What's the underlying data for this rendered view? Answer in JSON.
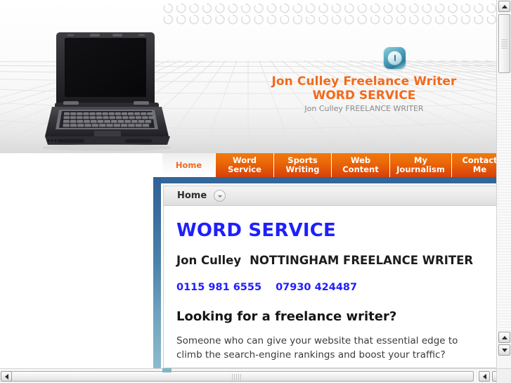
{
  "branding": {
    "logo_icon": "power-button-icon",
    "line1": "Jon Culley Freelance Writer",
    "line2": "WORD SERVICE",
    "tagline": "Jon Culley FREELANCE WRITER",
    "accent_orange": "#f26a1b",
    "accent_blue": "#1f1fff",
    "nav_blue": "#336699"
  },
  "hero": {
    "image_alt": "open-laptop-on-perspective-grid"
  },
  "nav": {
    "items": [
      {
        "label_line1": "Home",
        "label_line2": "",
        "active": true,
        "width": 76
      },
      {
        "label_line1": "Word",
        "label_line2": "Service",
        "active": false,
        "width": 83
      },
      {
        "label_line1": "Sports",
        "label_line2": "Writing",
        "active": false,
        "width": 82
      },
      {
        "label_line1": "Web",
        "label_line2": "Content",
        "active": false,
        "width": 83
      },
      {
        "label_line1": "My",
        "label_line2": "Journalism",
        "active": false,
        "width": 88
      },
      {
        "label_line1": "Contact",
        "label_line2": "Me",
        "active": false,
        "width": 80
      }
    ]
  },
  "breadcrumb": {
    "label": "Home",
    "caret_icon": "chevron-down-icon"
  },
  "content": {
    "heading": "WORD SERVICE",
    "byline_name": "Jon Culley",
    "byline_role": "NOTTINGHAM FREELANCE WRITER",
    "phone_landline": "0115 981 6555",
    "phone_mobile": "07930 424487",
    "subheading": "Looking for a freelance writer?",
    "paragraph": "Someone who can give your website that essential edge to climb the search-engine rankings and boost your traffic?"
  },
  "scrollbars": {
    "vertical_up_icon": "triangle-up-icon",
    "vertical_down_icon": "triangle-down-icon",
    "horizontal_left_icon": "triangle-left-icon",
    "horizontal_right_icon": "triangle-right-icon"
  }
}
